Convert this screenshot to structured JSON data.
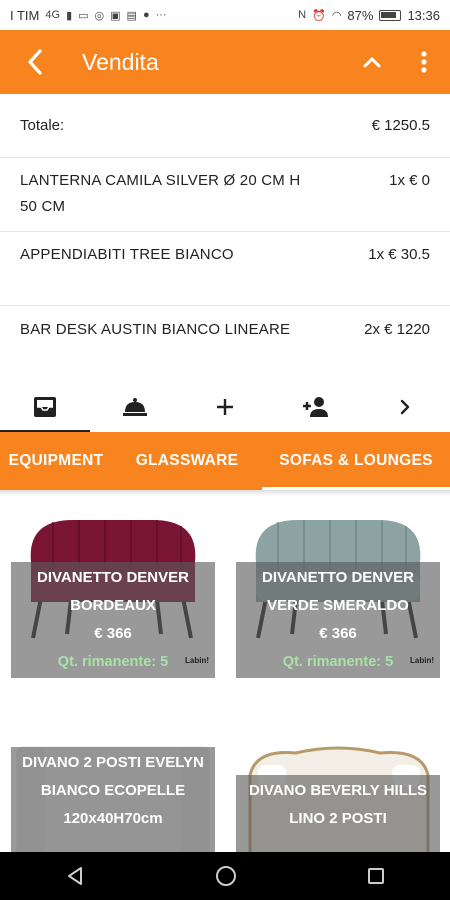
{
  "status_bar": {
    "carrier": "I TIM",
    "network": "4G",
    "more_indicator": "···",
    "battery_percent": "87%",
    "time": "13:36"
  },
  "app_bar": {
    "title": "Vendita",
    "back_icon": "arrow-left-icon",
    "collapse_icon": "chevron-up-icon",
    "menu_icon": "more-vertical-icon"
  },
  "order": {
    "total_label": "Totale:",
    "total_value": "€ 1250.5",
    "items": [
      {
        "name": "LANTERNA CAMILA SILVER Ø 20 CM H 50 CM",
        "qty_price": "1x € 0"
      },
      {
        "name": "APPENDIABITI TREE BIANCO",
        "qty_price": "1x € 30.5"
      },
      {
        "name": "BAR DESK AUSTIN BIANCO LINEARE",
        "qty_price": "2x € 1220"
      }
    ]
  },
  "tool_tabs": [
    {
      "icon": "inbox-icon",
      "selected": true
    },
    {
      "icon": "service-bell-icon",
      "selected": false
    },
    {
      "icon": "plus-icon",
      "selected": false
    },
    {
      "icon": "add-person-icon",
      "selected": false
    },
    {
      "icon": "chevron-right-icon",
      "selected": false
    }
  ],
  "categories": [
    {
      "label": "EQUIPMENT",
      "selected": false
    },
    {
      "label": "GLASSWARE",
      "selected": false
    },
    {
      "label": "SOFAS & LOUNGES",
      "selected": true
    }
  ],
  "products": [
    {
      "name_line1": "DIVANETTO DENVER",
      "name_line2": "BORDEAUX",
      "price": "€ 366",
      "qty": "Qt. rimanente: 5",
      "brand": "Labin!",
      "color": "#7a1535"
    },
    {
      "name_line1": "DIVANETTO DENVER",
      "name_line2": "VERDE SMERALDO",
      "price": "€ 366",
      "qty": "Qt. rimanente: 5",
      "brand": "Labin!",
      "color": "#8da3a3"
    },
    {
      "name_line1": "DIVANO 2 POSTI EVELYN",
      "name_line2": "BIANCO ECOPELLE",
      "name_line3": "120x40H70cm",
      "color": "#f4f4f4"
    },
    {
      "name_line1": "DIVANO BEVERLY HILLS",
      "name_line2": "LINO 2 POSTI",
      "color": "#f2efe9"
    }
  ],
  "colors": {
    "accent": "#f7841e",
    "qty_green": "#a8e2a6"
  }
}
